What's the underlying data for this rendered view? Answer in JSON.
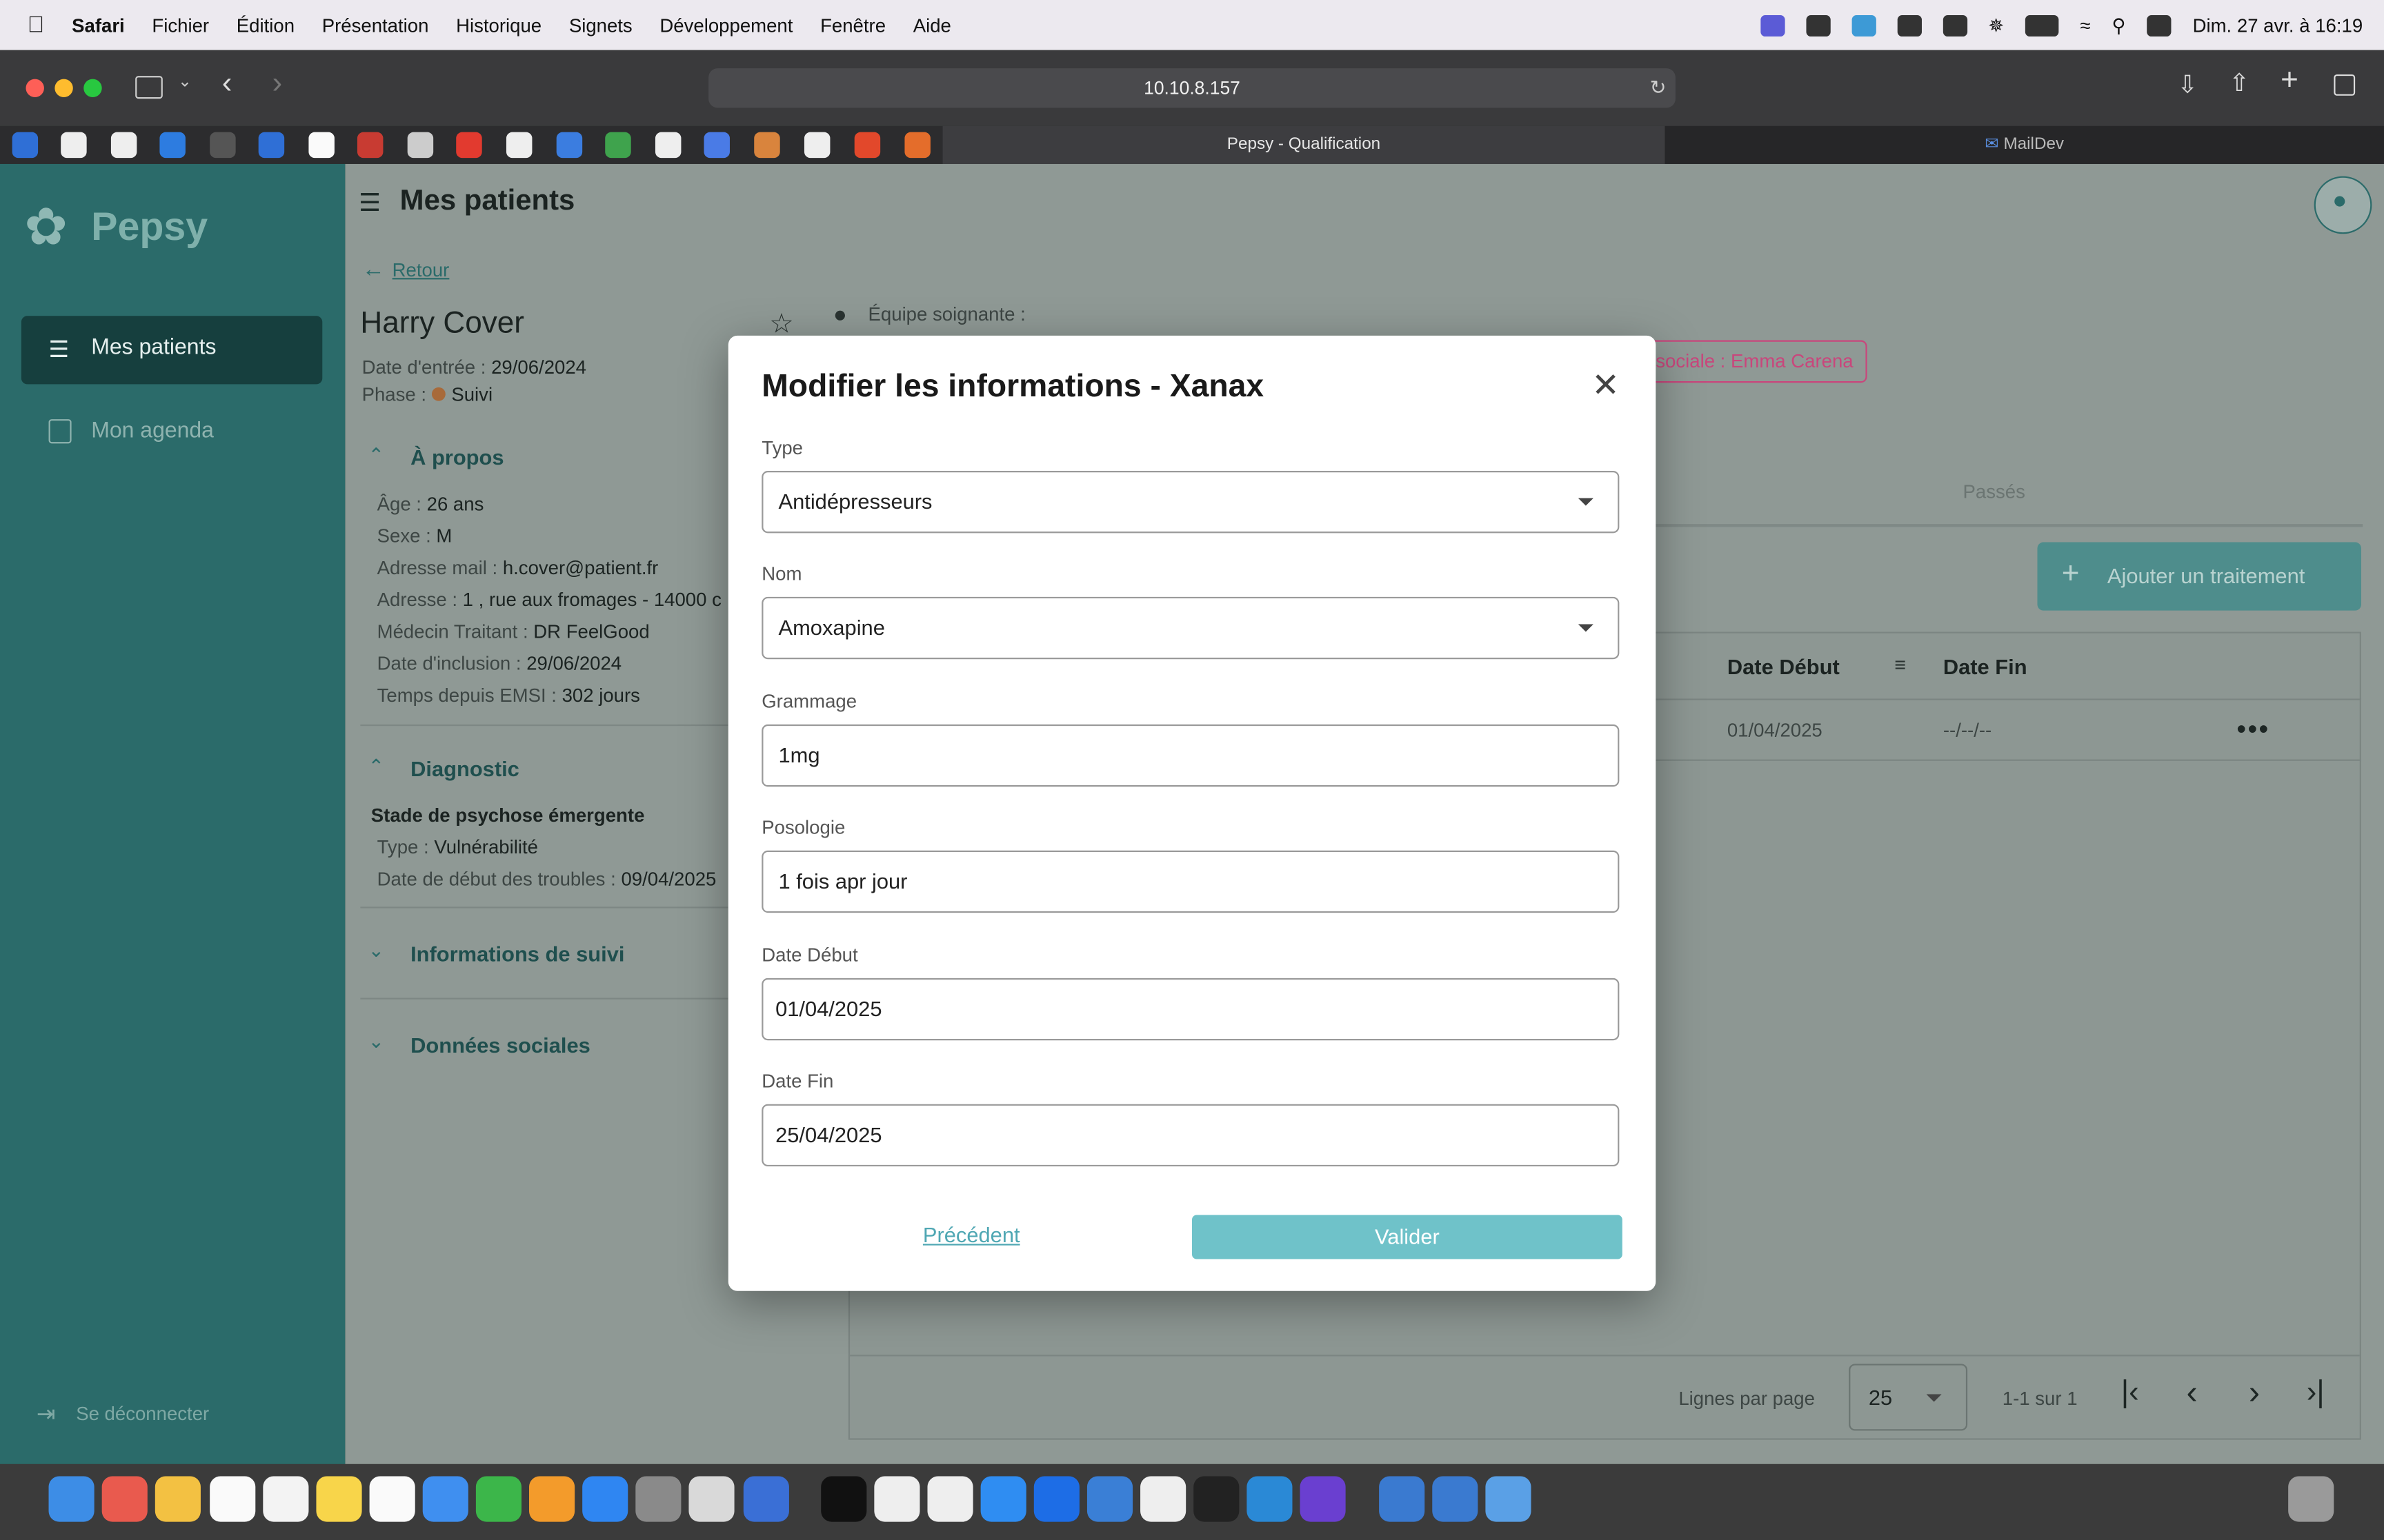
{
  "menubar": {
    "app": "Safari",
    "items": [
      "Fichier",
      "Édition",
      "Présentation",
      "Historique",
      "Signets",
      "Développement",
      "Fenêtre",
      "Aide"
    ],
    "clock": "Dim. 27 avr. à 16:19"
  },
  "browser": {
    "url": "10.10.8.157",
    "tabs": [
      {
        "label": "Pepsy - Qualification",
        "active": true
      },
      {
        "label": "MailDev",
        "active": false
      }
    ]
  },
  "sidebar": {
    "brand": "Pepsy",
    "items": [
      {
        "label": "Mes patients",
        "active": true,
        "icon": "patients-icon"
      },
      {
        "label": "Mon agenda",
        "active": false,
        "icon": "calendar-icon"
      }
    ],
    "logout": "Se déconnecter"
  },
  "page": {
    "title": "Mes patients",
    "back": "Retour",
    "patient": {
      "name": "Harry Cover",
      "entry_label": "Date d'entrée : ",
      "entry_date": "29/06/2024",
      "phase_label": "Phase : ",
      "phase": "Suivi"
    },
    "team_label": "Équipe soignante :",
    "team_chip": "sociale : Emma Carena",
    "about": {
      "title": "À propos",
      "rows": [
        {
          "k": "Âge : ",
          "v": "26 ans"
        },
        {
          "k": "Sexe : ",
          "v": "M"
        },
        {
          "k": "Adresse mail : ",
          "v": "h.cover@patient.fr"
        },
        {
          "k": "Adresse : ",
          "v": "1 , rue aux fromages - 14000 c"
        },
        {
          "k": "Médecin Traitant : ",
          "v": "DR FeelGood"
        },
        {
          "k": "Date d'inclusion : ",
          "v": "29/06/2024"
        },
        {
          "k": "Temps depuis EMSI : ",
          "v": "302 jours"
        }
      ]
    },
    "diagnostic": {
      "title": "Diagnostic",
      "stage": "Stade de psychose émergente",
      "rows": [
        {
          "k": "Type : ",
          "v": "Vulnérabilité"
        },
        {
          "k": "Date de début des troubles : ",
          "v": "09/04/2025"
        }
      ]
    },
    "sections": [
      "Informations de suivi",
      "Données sociales"
    ],
    "tabs_right": "Passés",
    "add_button": "Ajouter un traitement",
    "table": {
      "headers": [
        "Date Début",
        "Date Fin"
      ],
      "row": {
        "start": "01/04/2025",
        "end": "--/--/--"
      }
    },
    "pagination": {
      "label": "Lignes par page",
      "size": "25",
      "range": "1-1 sur 1"
    }
  },
  "modal": {
    "title": "Modifier les informations - Xanax",
    "fields": [
      {
        "label": "Type",
        "value": "Antidépresseurs",
        "select": true
      },
      {
        "label": "Nom",
        "value": "Amoxapine",
        "select": true
      },
      {
        "label": "Grammage",
        "value": "1mg",
        "select": false
      },
      {
        "label": "Posologie",
        "value": "1 fois apr jour",
        "select": false
      },
      {
        "label": "Date Début",
        "value": "01/04/2025",
        "select": false
      },
      {
        "label": "Date Fin",
        "value": "25/04/2025",
        "select": false
      }
    ],
    "prev": "Précédent",
    "ok": "Valider"
  },
  "colors": {
    "sidebar": "#2b6b6a",
    "accent": "#6fc2c9",
    "chip": "#d0457a"
  }
}
